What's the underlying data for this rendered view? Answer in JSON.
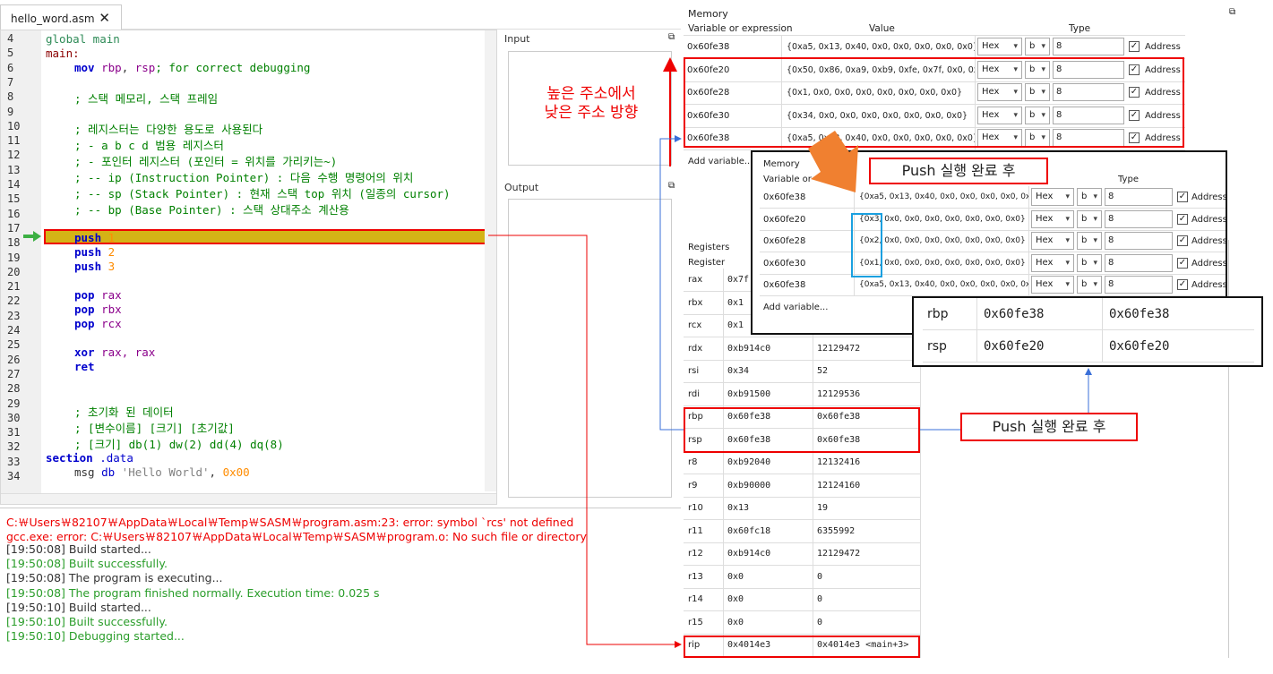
{
  "tab": {
    "filename": "hello_word.asm"
  },
  "editor": {
    "lines": [
      {
        "n": "4"
      },
      {
        "n": "5"
      },
      {
        "n": "6"
      },
      {
        "n": "7"
      },
      {
        "n": "8"
      },
      {
        "n": "9"
      },
      {
        "n": "10"
      },
      {
        "n": "11"
      },
      {
        "n": "12"
      },
      {
        "n": "13"
      },
      {
        "n": "14"
      },
      {
        "n": "15"
      },
      {
        "n": "16"
      },
      {
        "n": "17"
      },
      {
        "n": "18"
      },
      {
        "n": "19"
      },
      {
        "n": "20"
      },
      {
        "n": "21"
      },
      {
        "n": "22"
      },
      {
        "n": "23"
      },
      {
        "n": "24"
      },
      {
        "n": "25"
      },
      {
        "n": "26"
      },
      {
        "n": "27"
      },
      {
        "n": "28"
      },
      {
        "n": "29"
      },
      {
        "n": "30"
      },
      {
        "n": "31"
      },
      {
        "n": "32"
      },
      {
        "n": "33"
      },
      {
        "n": "34"
      }
    ],
    "code": {
      "l4a": "global",
      "l4b": " main",
      "l5": "main:",
      "l6a": "mov",
      "l6b": " rbp",
      "l6c": ",",
      "l6d": " rsp",
      "l6e": "; for correct debugging",
      "l8": "; 스택 메모리, 스택 프레임",
      "l10": "; 레지스터는 다양한 용도로 사용된다",
      "l11": "; - a b c d 범용 레지스터",
      "l12": "; - 포인터 레지스터 (포인터 = 위치를 가리키는~)",
      "l13": "; -- ip (Instruction Pointer) : 다음 수행 명령어의 위치",
      "l14": "; -- sp (Stack Pointer) : 현재 스택 top 위치 (일종의 cursor)",
      "l15": "; -- bp (Base Pointer) : 스택 상대주소 계산용",
      "push": "push",
      "pop": "pop",
      "xor": "xor",
      "ret": "ret",
      "one": "1",
      "two": "2",
      "three": "3",
      "rax": "rax",
      "rbx": "rbx",
      "rcx": "rcx",
      "rax2": ", rax",
      "l29": "; 초기화 된 데이터",
      "l30": "; [변수이름] [크기] [초기값]",
      "l31": "; [크기] db(1) dw(2) dd(4) dq(8)",
      "l32a": "section",
      "l32b": " .data",
      "l33a": "msg",
      "l33b": " db",
      "l33c": " 'Hello World'",
      ",": ",",
      "l33d": " 0x00"
    }
  },
  "input": {
    "title": "Input"
  },
  "output": {
    "title": "Output"
  },
  "log": [
    {
      "text": "C:￦Users￦82107￦AppData￦Local￦Temp￦SASM￦program.asm:23: error: symbol `rcs' not defined",
      "color": "#e00"
    },
    {
      "text": "gcc.exe: error: C:￦Users￦82107￦AppData￦Local￦Temp￦SASM￦program.o: No such file or directory",
      "color": "#e00"
    },
    {
      "text": "[19:50:08] Build started...",
      "color": "#333"
    },
    {
      "text": "[19:50:08] Built successfully.",
      "color": "#2a9d2a"
    },
    {
      "text": "[19:50:08] The program is executing...",
      "color": "#333"
    },
    {
      "text": "[19:50:08] The program finished normally. Execution time: 0.025 s",
      "color": "#2a9d2a"
    },
    {
      "text": "[19:50:10] Build started...",
      "color": "#333"
    },
    {
      "text": "[19:50:10] Built successfully.",
      "color": "#2a9d2a"
    },
    {
      "text": "[19:50:10] Debugging started...",
      "color": "#2a9d2a"
    }
  ],
  "memory": {
    "title": "Memory",
    "headers": {
      "var": "Variable or expression",
      "value": "Value",
      "type": "Type"
    },
    "rows": [
      {
        "addr": "0x60fe38",
        "value": "{0xa5, 0x13, 0x40, 0x0, 0x0, 0x0, 0x0, 0x0}",
        "fmt": "Hex",
        "unit": "b",
        "count": "8",
        "check": "Address"
      },
      {
        "addr": "0x60fe20",
        "value": "{0x50, 0x86, 0xa9, 0xb9, 0xfe, 0x7f, 0x0, 0x0}",
        "fmt": "Hex",
        "unit": "b",
        "count": "8",
        "check": "Address"
      },
      {
        "addr": "0x60fe28",
        "value": "{0x1, 0x0, 0x0, 0x0, 0x0, 0x0, 0x0, 0x0}",
        "fmt": "Hex",
        "unit": "b",
        "count": "8",
        "check": "Address"
      },
      {
        "addr": "0x60fe30",
        "value": "{0x34, 0x0, 0x0, 0x0, 0x0, 0x0, 0x0, 0x0}",
        "fmt": "Hex",
        "unit": "b",
        "count": "8",
        "check": "Address"
      },
      {
        "addr": "0x60fe38",
        "value": "{0xa5, 0x13, 0x40, 0x0, 0x0, 0x0, 0x0, 0x0}",
        "fmt": "Hex",
        "unit": "b",
        "count": "8",
        "check": "Address"
      }
    ],
    "add": "Add variable..."
  },
  "overlay": {
    "title": "Memory",
    "var": "Variable or",
    "type": "Type",
    "rows": [
      {
        "addr": "0x60fe38",
        "value": "{0xa5, 0x13, 0x40, 0x0, 0x0, 0x0, 0x0, 0x0}"
      },
      {
        "addr": "0x60fe20",
        "value": "{0x3, 0x0, 0x0, 0x0, 0x0, 0x0, 0x0, 0x0}"
      },
      {
        "addr": "0x60fe28",
        "value": "{0x2, 0x0, 0x0, 0x0, 0x0, 0x0, 0x0, 0x0}"
      },
      {
        "addr": "0x60fe30",
        "value": "{0x1, 0x0, 0x0, 0x0, 0x0, 0x0, 0x0, 0x0}"
      },
      {
        "addr": "0x60fe38",
        "value": "{0xa5, 0x13, 0x40, 0x0, 0x0, 0x0, 0x0, 0x0}"
      }
    ],
    "fmt": "Hex",
    "unit": "b",
    "count": "8",
    "check": "Address",
    "add": "Add variable..."
  },
  "registers": {
    "title": "Registers",
    "header": "Register",
    "rows": [
      {
        "name": "rax",
        "hex": "0x7f",
        "dec": ""
      },
      {
        "name": "rbx",
        "hex": "0x1",
        "dec": ""
      },
      {
        "name": "rcx",
        "hex": "0x1",
        "dec": ""
      },
      {
        "name": "rdx",
        "hex": "0xb914c0",
        "dec": "12129472"
      },
      {
        "name": "rsi",
        "hex": "0x34",
        "dec": "52"
      },
      {
        "name": "rdi",
        "hex": "0xb91500",
        "dec": "12129536"
      },
      {
        "name": "rbp",
        "hex": "0x60fe38",
        "dec": "0x60fe38"
      },
      {
        "name": "rsp",
        "hex": "0x60fe38",
        "dec": "0x60fe38"
      },
      {
        "name": "r8",
        "hex": "0xb92040",
        "dec": "12132416"
      },
      {
        "name": "r9",
        "hex": "0xb90000",
        "dec": "12124160"
      },
      {
        "name": "r10",
        "hex": "0x13",
        "dec": "19"
      },
      {
        "name": "r11",
        "hex": "0x60fc18",
        "dec": "6355992"
      },
      {
        "name": "r12",
        "hex": "0xb914c0",
        "dec": "12129472"
      },
      {
        "name": "r13",
        "hex": "0x0",
        "dec": "0"
      },
      {
        "name": "r14",
        "hex": "0x0",
        "dec": "0"
      },
      {
        "name": "r15",
        "hex": "0x0",
        "dec": "0"
      },
      {
        "name": "rip",
        "hex": "0x4014e3",
        "dec": "0x4014e3 <main+3>"
      }
    ]
  },
  "zoomRegs": [
    {
      "name": "rbp",
      "hex": "0x60fe38",
      "dec": "0x60fe38"
    },
    {
      "name": "rsp",
      "hex": "0x60fe20",
      "dec": "0x60fe20"
    }
  ],
  "annotations": {
    "dir1": "높은 주소에서",
    "dir2": "낮은 주소 방향",
    "push_done_top": "Push 실행 완료 후",
    "push_done_bottom": "Push 실행 완료 후"
  },
  "colors": {
    "highlight": "#d4b316",
    "annotation": "#e00",
    "arrow": "#f08030",
    "blue": "#1aa0e0"
  }
}
